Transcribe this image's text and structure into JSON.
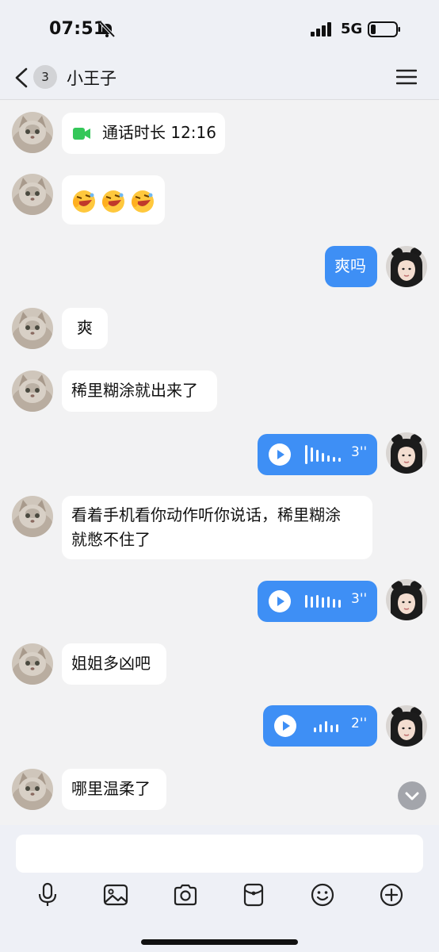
{
  "status_bar": {
    "time": "07:51",
    "network": "5G"
  },
  "header": {
    "unread_count": "3",
    "title": "小王子"
  },
  "messages": {
    "m1_call": "通话时长 12:16",
    "m3_text": "爽吗",
    "m4_text": "爽",
    "m5_text": "稀里糊涂就出来了",
    "m6_voice": "3''",
    "m7_line1": "看着手机看你动作听你说话，稀里糊涂",
    "m7_line2": "就憋不住了",
    "m8_voice": "3''",
    "m9_text": "姐姐多凶吧",
    "m10_voice": "2''",
    "m11_text": "哪里温柔了"
  },
  "input": {
    "placeholder": ""
  },
  "colors": {
    "outgoing_bubble": "#3e8ff5",
    "incoming_bubble": "#ffffff",
    "background": "#f2f2f3",
    "call_icon": "#34c759"
  },
  "icons": {
    "status": [
      "bell-slash-icon",
      "signal-icon",
      "battery-icon"
    ],
    "header": [
      "back-icon",
      "menu-icon"
    ],
    "toolbar": [
      "microphone-icon",
      "image-icon",
      "camera-icon",
      "red-packet-icon",
      "emoji-icon",
      "plus-icon"
    ]
  }
}
